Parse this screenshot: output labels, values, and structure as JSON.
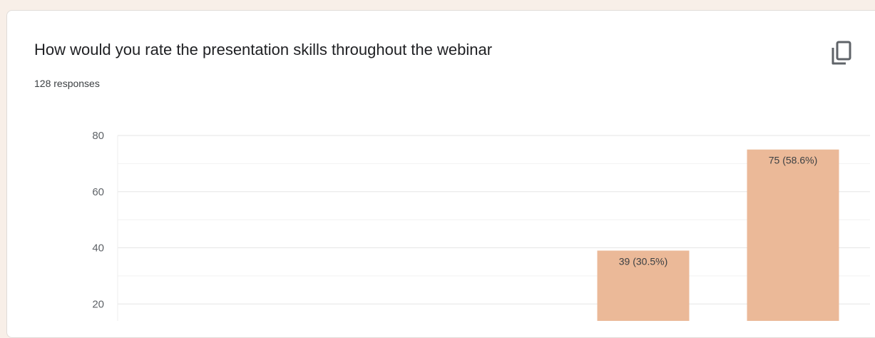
{
  "question": {
    "title": "How would you rate the presentation skills throughout the webinar",
    "responses_text": "128 responses"
  },
  "toolbar": {
    "copy_icon": "copy-icon"
  },
  "colors": {
    "bar": "#ebb998",
    "grid": "#e8e8e8",
    "background": "#f8efe8"
  },
  "chart_data": {
    "type": "bar",
    "categories": [
      "",
      "",
      "",
      "",
      ""
    ],
    "values": [
      null,
      null,
      null,
      39,
      75
    ],
    "data_labels": [
      "",
      "",
      "",
      "39 (30.5%)",
      "75 (58.6%)"
    ],
    "yticks": [
      20,
      40,
      60,
      80
    ],
    "ylim": [
      0,
      80
    ],
    "grid": true
  }
}
